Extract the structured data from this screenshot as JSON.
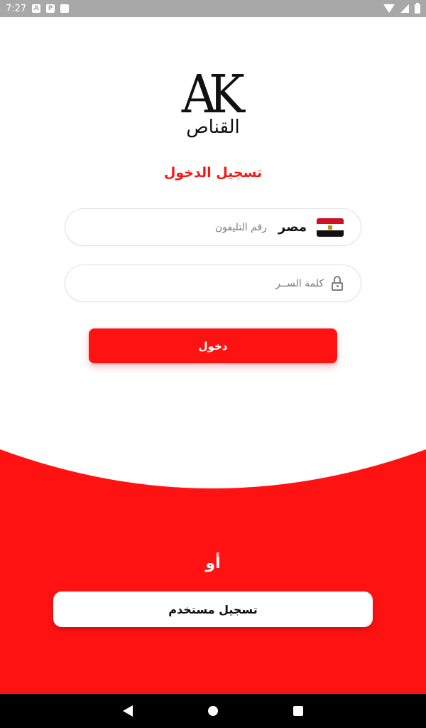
{
  "status_bar": {
    "time": "7:27",
    "icons": [
      "a-icon",
      "p-icon",
      "sd-icon"
    ],
    "wifi": "wifi-icon",
    "signal": "signal-icon",
    "battery": "battery-icon"
  },
  "logo": {
    "mark": "AK",
    "name": "القناص"
  },
  "login": {
    "title": "تسجيل الدخول",
    "phone": {
      "country": "مصر",
      "flag": "egypt-flag",
      "placeholder": "رقم التليفون",
      "value": ""
    },
    "password": {
      "placeholder": "كلمة الســر",
      "value": ""
    },
    "submit_label": "دخول"
  },
  "signup": {
    "divider": "أو",
    "button_label": "تسجيل مستخدم"
  },
  "colors": {
    "accent": "#ff1212",
    "title": "#fe1414",
    "background": "#ffffff"
  },
  "nav_bar": {
    "back": "back-icon",
    "home": "home-icon",
    "recent": "recent-apps-icon"
  }
}
